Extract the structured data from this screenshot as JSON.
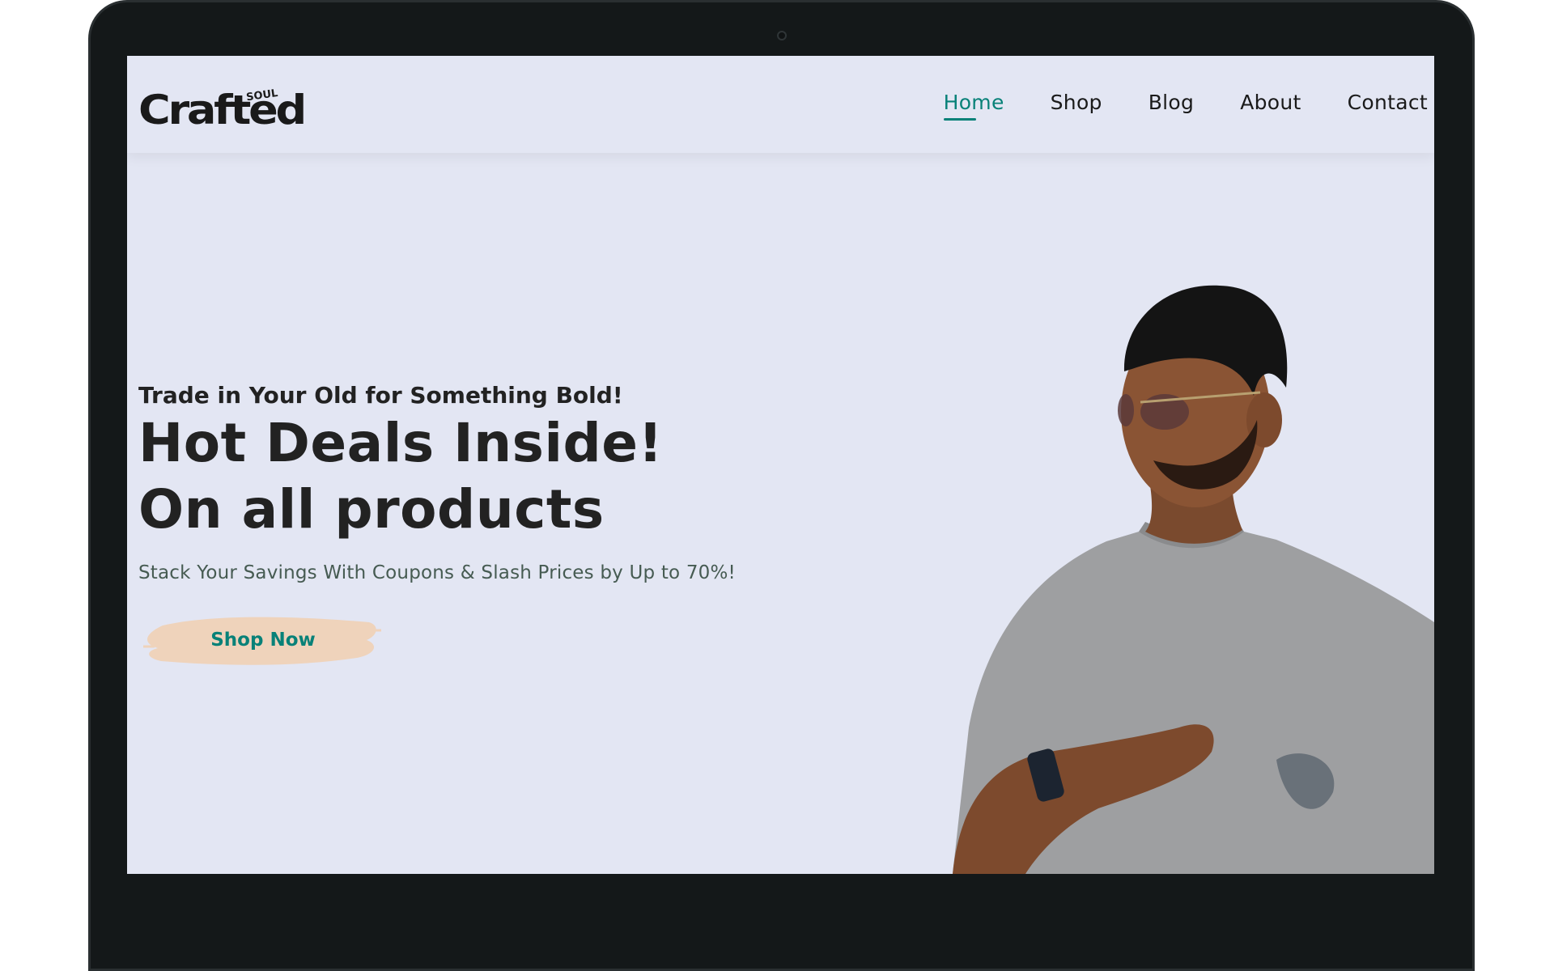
{
  "brand": {
    "logo_main": "Crafted",
    "logo_small": "SOUL"
  },
  "nav": {
    "items": [
      {
        "label": "Home",
        "active": true
      },
      {
        "label": "Shop",
        "active": false
      },
      {
        "label": "Blog",
        "active": false
      },
      {
        "label": "About",
        "active": false
      },
      {
        "label": "Contact",
        "active": false
      }
    ]
  },
  "hero": {
    "tagline": "Trade in Your Old for Something Bold!",
    "title_line1": "Hot Deals Inside!",
    "title_line2": "On all products",
    "subtitle": "Stack Your Savings With Coupons & Slash Prices by Up to 70%!",
    "button_label": "Shop Now"
  },
  "colors": {
    "accent": "#088178",
    "page_background": "#e3e6f3",
    "button_brush": "#efd3bb",
    "bezel": "#141819"
  }
}
